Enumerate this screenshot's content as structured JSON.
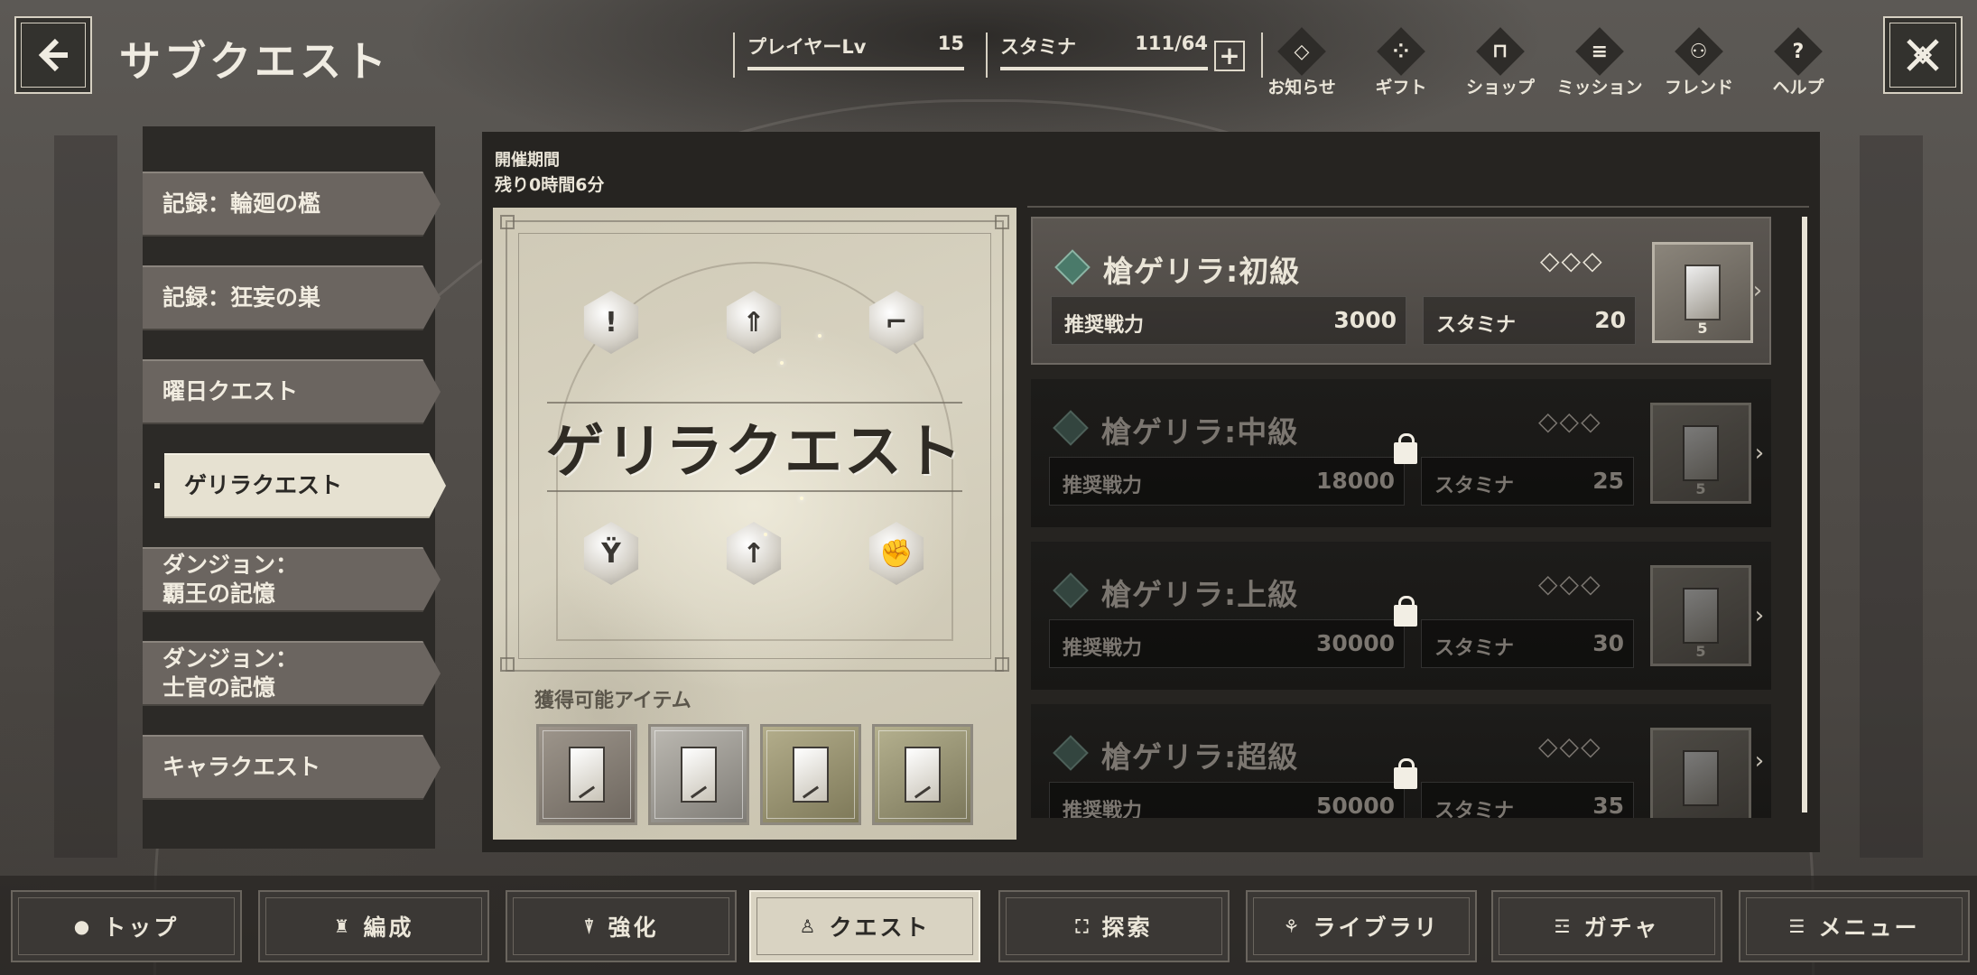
{
  "header": {
    "title": "サブクエスト",
    "player_level_label": "プレイヤーLv",
    "player_level_value": "15",
    "stamina_label": "スタミナ",
    "stamina_value": "111/64",
    "stamina_plus": "+",
    "nav": [
      {
        "label": "お知らせ",
        "icon": "notice-icon",
        "glyph": "◇"
      },
      {
        "label": "ギフト",
        "icon": "gift-icon",
        "glyph": "⁘"
      },
      {
        "label": "ショップ",
        "icon": "shop-icon",
        "glyph": "⊓"
      },
      {
        "label": "ミッション",
        "icon": "mission-icon",
        "glyph": "≡"
      },
      {
        "label": "フレンド",
        "icon": "friend-icon",
        "glyph": "⚇"
      },
      {
        "label": "ヘルプ",
        "icon": "help-icon",
        "glyph": "?"
      }
    ]
  },
  "sidebar": {
    "items": [
      {
        "label": "記録：輪廻の檻",
        "active": false
      },
      {
        "label": "記録：狂妄の巣",
        "active": false
      },
      {
        "label": "曜日クエスト",
        "active": false
      },
      {
        "label": "ゲリラクエスト",
        "active": true
      },
      {
        "label": "ダンジョン：\n覇王の記憶",
        "active": false
      },
      {
        "label": "ダンジョン：\n士官の記憶",
        "active": false
      },
      {
        "label": "キャラクエスト",
        "active": false
      }
    ]
  },
  "event": {
    "period_label": "開催期間",
    "remaining": "残り0時間6分",
    "banner_title": "ゲリラクエスト",
    "items_label": "獲得可能アイテム"
  },
  "quests": [
    {
      "title": "槍ゲリラ:初級",
      "rank": "◇◇◇",
      "power_label": "推奨戦力",
      "power": "3000",
      "stamina_label": "スタミナ",
      "stamina": "20",
      "reward_count": "5",
      "locked": false
    },
    {
      "title": "槍ゲリラ:中級",
      "rank": "◇◇◇",
      "power_label": "推奨戦力",
      "power": "18000",
      "stamina_label": "スタミナ",
      "stamina": "25",
      "reward_count": "5",
      "locked": true
    },
    {
      "title": "槍ゲリラ:上級",
      "rank": "◇◇◇",
      "power_label": "推奨戦力",
      "power": "30000",
      "stamina_label": "スタミナ",
      "stamina": "30",
      "reward_count": "5",
      "locked": true
    },
    {
      "title": "槍ゲリラ:超級",
      "rank": "◇◇◇",
      "power_label": "推奨戦力",
      "power": "50000",
      "stamina_label": "スタミナ",
      "stamina": "35",
      "reward_count": "",
      "locked": true
    }
  ],
  "tabs": [
    {
      "label": "トップ",
      "icon": "top-icon",
      "glyph": "●"
    },
    {
      "label": "編成",
      "icon": "formation-icon",
      "glyph": "♜"
    },
    {
      "label": "強化",
      "icon": "enhance-icon",
      "glyph": "⍒"
    },
    {
      "label": "クエスト",
      "icon": "quest-icon",
      "glyph": "♙",
      "active": true
    },
    {
      "label": "探索",
      "icon": "explore-icon",
      "glyph": "⛶"
    },
    {
      "label": "ライブラリ",
      "icon": "library-icon",
      "glyph": "⚘"
    },
    {
      "label": "ガチャ",
      "icon": "gacha-icon",
      "glyph": "☲"
    },
    {
      "label": "メニュー",
      "icon": "menu-icon",
      "glyph": "☰"
    }
  ]
}
